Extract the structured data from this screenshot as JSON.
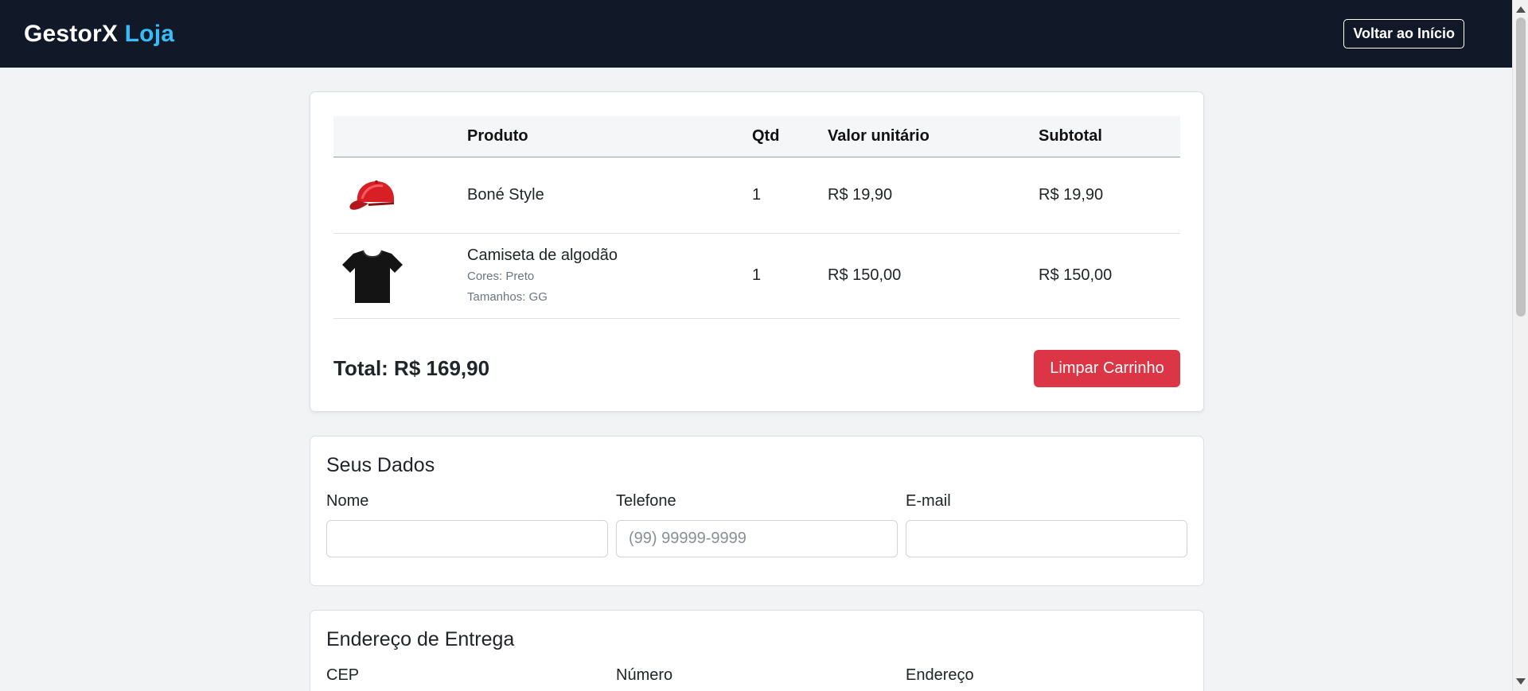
{
  "header": {
    "brand_main": "GestorX",
    "brand_accent": "Loja",
    "back_button": "Voltar ao Início"
  },
  "cart": {
    "columns": [
      "",
      "Produto",
      "Qtd",
      "Valor unitário",
      "Subtotal"
    ],
    "items": [
      {
        "image_icon": "red-cap-icon",
        "name": "Boné Style",
        "qty": "1",
        "unit_price": "R$ 19,90",
        "subtotal": "R$ 19,90"
      },
      {
        "image_icon": "black-tshirt-icon",
        "name": "Camiseta de algodão",
        "colors": "Cores: Preto",
        "sizes": "Tamanhos: GG",
        "qty": "1",
        "unit_price": "R$ 150,00",
        "subtotal": "R$ 150,00"
      }
    ],
    "total": "Total: R$ 169,90",
    "clear_button": "Limpar Carrinho"
  },
  "dados": {
    "title": "Seus Dados",
    "nome_label": "Nome",
    "nome_value": "",
    "telefone_label": "Telefone",
    "telefone_placeholder": "(99) 99999-9999",
    "email_label": "E-mail",
    "email_value": ""
  },
  "endereco": {
    "title": "Endereço de Entrega",
    "cep_label": "CEP",
    "numero_label": "Número",
    "endereco_label": "Endereço"
  },
  "colors": {
    "header_bg": "#111827",
    "brand_accent": "#38bdf8",
    "danger": "#dc3545",
    "page_bg": "#f2f3f5"
  }
}
